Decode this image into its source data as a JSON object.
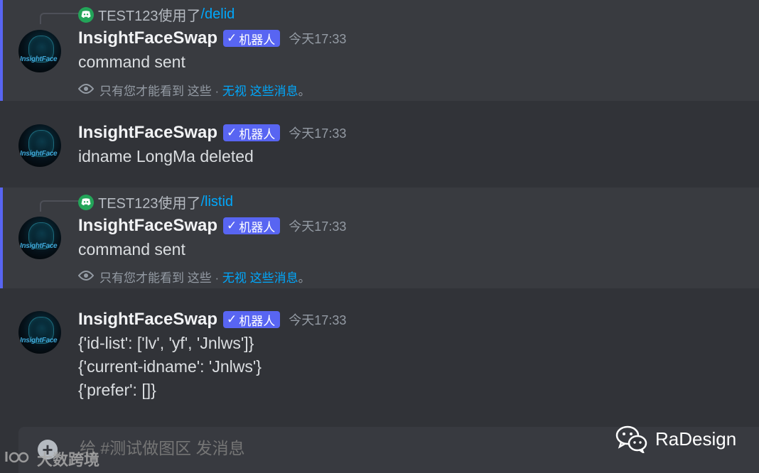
{
  "messages": [
    {
      "reply": {
        "user_text": "TEST123使用了",
        "command": "/delid"
      },
      "username": "InsightFaceSwap",
      "bot_label": "机器人",
      "timestamp": "今天17:33",
      "lines": [
        "command sent"
      ],
      "ephemeral": {
        "prefix": "只有您才能看到 这些 · ",
        "dismiss": "无视",
        "suffix_link": "这些消息",
        "end": "。"
      },
      "avatar_text": "InsightFace"
    },
    {
      "username": "InsightFaceSwap",
      "bot_label": "机器人",
      "timestamp": "今天17:33",
      "lines": [
        "idname LongMa deleted"
      ],
      "avatar_text": "InsightFace"
    },
    {
      "reply": {
        "user_text": "TEST123使用了",
        "command": "/listid"
      },
      "username": "InsightFaceSwap",
      "bot_label": "机器人",
      "timestamp": "今天17:33",
      "lines": [
        "command sent"
      ],
      "ephemeral": {
        "prefix": "只有您才能看到 这些 · ",
        "dismiss": "无视",
        "suffix_link": "这些消息",
        "end": "。"
      },
      "avatar_text": "InsightFace"
    },
    {
      "username": "InsightFaceSwap",
      "bot_label": "机器人",
      "timestamp": "今天17:33",
      "lines": [
        "{'id-list': ['lv', 'yf', 'Jnlws']}",
        "{'current-idname': 'Jnlws'}",
        "{'prefer': []}"
      ],
      "avatar_text": "InsightFace"
    }
  ],
  "composer": {
    "placeholder": "给 #测试做图区 发消息",
    "plus": "+"
  },
  "watermarks": {
    "left": "大数跨境",
    "right": "RaDesign"
  },
  "colors": {
    "accent": "#5865f2",
    "link": "#00a8fc",
    "background": "#313338",
    "ephemeral_bg": "#393b40"
  }
}
